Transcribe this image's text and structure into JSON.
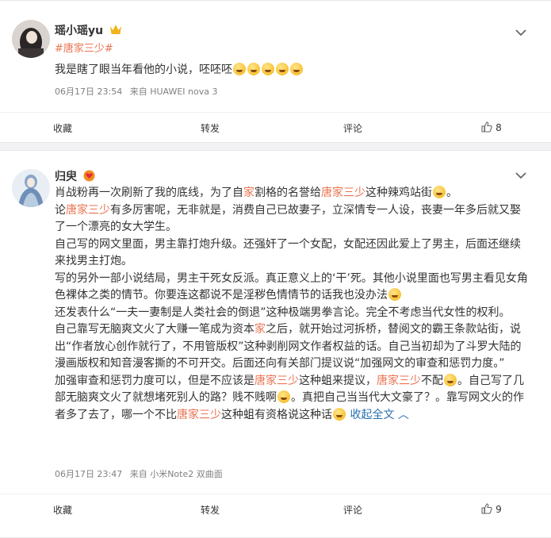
{
  "post1": {
    "username": "瑶小瑶yu",
    "hashtag": "#唐家三少#",
    "text": "我是瞎了眼当年看他的小说，呸呸呸",
    "time": "06月17日 23:54",
    "source": "来自 HUAWEI nova 3",
    "actions": {
      "favorite": "收藏",
      "repost": "转发",
      "comment": "评论",
      "likes": "8"
    }
  },
  "post2": {
    "username": "归臾",
    "lines": [
      "肖战粉再一次刷新了我的底线，为了自家割格的名誉给唐家三少这种辣鸡站街",
      "论唐家三少有多厉害呢，无非就是，消费自己已故妻子，立深情专一人设，丧妻一年多后就又娶",
      "了一个漂亮的女大学生。",
      "自己写的网文里面，男主靠打炮升级。还强奸了一个女配，女配还因此爱上了男主，后面还继续",
      "来找男主打炮。",
      "写的另外一部小说结局，男主干死女反派。真正意义上的‘干’死。其他小说里面也写男主看见女角",
      "色裸体之类的情节。你要连这都说不是淫秽色情情节的话我也没办法",
      "还发表什么“一夫一妻制是人类社会的倒退”这种极端男拳言论。完全不考虑当代女性的权利。",
      "自己靠写无脑爽文火了大赚一笔成为资本家之后，就开始过河拆桥，替阅文的霸王条款站街，说",
      "出“作者放心创作就行了，不用管版权”这种剥削网文作者权益的话。自己当初却为了斗罗大陆的",
      "漫画版权和知音漫客撕的不可开交。后面还向有关部门提议说“加强网文的审查和惩罚力度。”",
      "加强审查和惩罚力度可以，但是不应该是唐家三少这种蛆来提议，唐家三少不配",
      "部无脑爽文火了就想堵死别人的路？贱不贱啊",
      "者多了去了，哪一个不比唐家三少这种蛆有资格说这种话"
    ],
    "seg": {
      "l1a": "肖战粉再一次刷新了我的底线，为了自",
      "l1b": "家",
      "l1c": "割格的名誉给",
      "l1d": "唐家三少",
      "l1e": "这种辣鸡站街",
      "l2a": "论",
      "l2b": "唐家三少",
      "l2c": "有多厉害呢，无非就是，消费自己已故妻子，立深情专一人设，丧妻一年多后就又娶",
      "l9a": "自己靠写无脑爽文火了大赚一笔成为资本",
      "l9b": "家",
      "l9c": "之后，就开始过河拆桥，替阅文的霸王条款站街，说",
      "l12a": "加强审查和惩罚力度可以，但是不应该是",
      "l12b": "唐家三少",
      "l12c": "这种蛆来提议，",
      "l12d": "唐家三少",
      "l12e": "不配",
      "l12f": "。自己写了几",
      "l13a": "部无脑爽文火了就想堵死别人的路？贱不贱啊",
      "l13b": "。真把自己当当代大文豪了？。靠写网文火的作",
      "l14a": "者多了去了，哪一个不比",
      "l14b": "唐家三少",
      "l14c": "这种蛆有资格说这种话",
      "collapse": "收起全文"
    },
    "time": "06月17日 23:47",
    "source": "来自 小米Note2 双曲面",
    "actions": {
      "favorite": "收藏",
      "repost": "转发",
      "comment": "评论",
      "likes": "9"
    }
  },
  "colors": {
    "accent": "#eb7350",
    "link_blue": "#2a6fb1",
    "vip_gold": "#f2b41d"
  }
}
